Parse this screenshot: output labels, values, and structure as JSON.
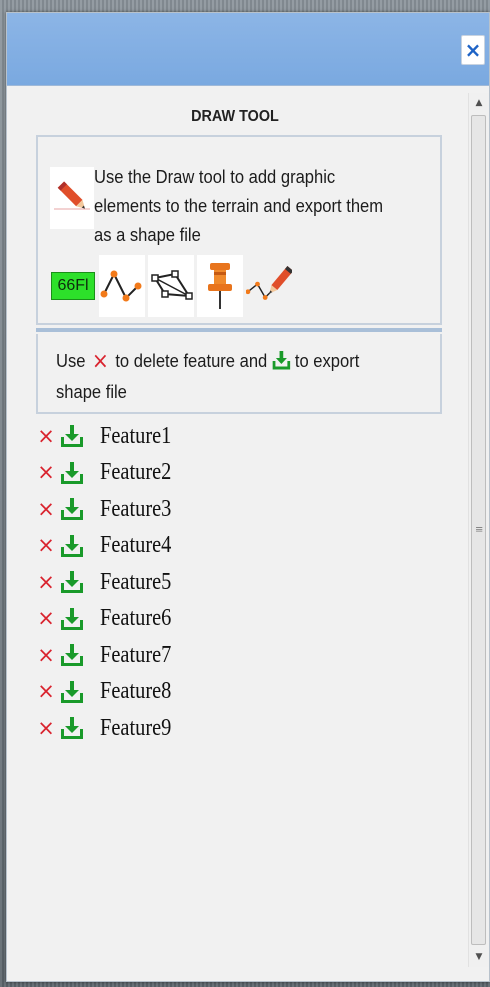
{
  "window": {
    "close_label": "×"
  },
  "draw_tool": {
    "title": "DRAW TOOL",
    "intro_text": "Use the Draw tool to add graphic elements to the terrain and export them as a shape file",
    "counter_text": "66Fl",
    "tools": [
      {
        "name": "pencil-icon"
      },
      {
        "name": "line-tool-icon"
      },
      {
        "name": "polygon-tool-icon"
      },
      {
        "name": "pin-tool-icon"
      },
      {
        "name": "freehand-draw-icon"
      }
    ],
    "info": {
      "use_label": "Use",
      "delete_label": "to delete feature and",
      "export_label": "to export shape file"
    }
  },
  "features": [
    {
      "name": "Feature1"
    },
    {
      "name": "Feature2"
    },
    {
      "name": "Feature3"
    },
    {
      "name": "Feature4"
    },
    {
      "name": "Feature5"
    },
    {
      "name": "Feature6"
    },
    {
      "name": "Feature7"
    },
    {
      "name": "Feature8"
    },
    {
      "name": "Feature9"
    }
  ],
  "colors": {
    "titlebar": "#8cb5e6",
    "delete": "#d9232e",
    "export": "#1a9a2a",
    "counter": "#2de02a"
  }
}
